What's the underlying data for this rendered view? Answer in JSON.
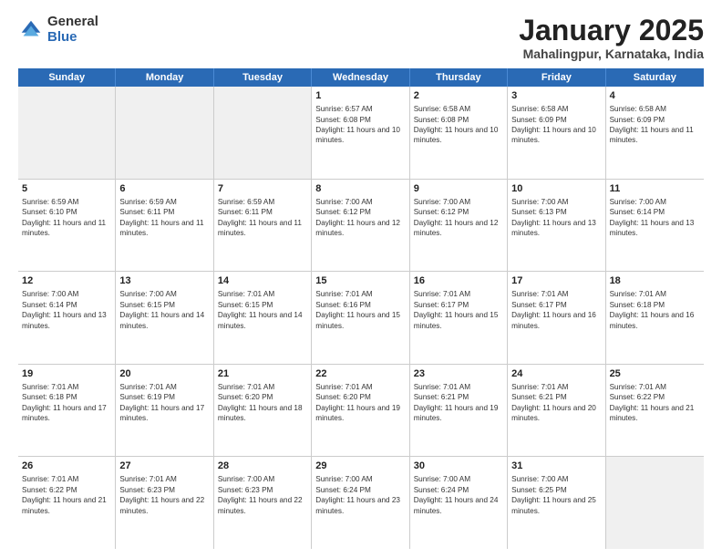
{
  "logo": {
    "general": "General",
    "blue": "Blue"
  },
  "title": {
    "month": "January 2025",
    "location": "Mahalingpur, Karnataka, India"
  },
  "header_days": [
    "Sunday",
    "Monday",
    "Tuesday",
    "Wednesday",
    "Thursday",
    "Friday",
    "Saturday"
  ],
  "weeks": [
    [
      {
        "day": "",
        "info": "",
        "shaded": true
      },
      {
        "day": "",
        "info": "",
        "shaded": true
      },
      {
        "day": "",
        "info": "",
        "shaded": true
      },
      {
        "day": "1",
        "info": "Sunrise: 6:57 AM\nSunset: 6:08 PM\nDaylight: 11 hours and 10 minutes."
      },
      {
        "day": "2",
        "info": "Sunrise: 6:58 AM\nSunset: 6:08 PM\nDaylight: 11 hours and 10 minutes."
      },
      {
        "day": "3",
        "info": "Sunrise: 6:58 AM\nSunset: 6:09 PM\nDaylight: 11 hours and 10 minutes."
      },
      {
        "day": "4",
        "info": "Sunrise: 6:58 AM\nSunset: 6:09 PM\nDaylight: 11 hours and 11 minutes."
      }
    ],
    [
      {
        "day": "5",
        "info": "Sunrise: 6:59 AM\nSunset: 6:10 PM\nDaylight: 11 hours and 11 minutes."
      },
      {
        "day": "6",
        "info": "Sunrise: 6:59 AM\nSunset: 6:11 PM\nDaylight: 11 hours and 11 minutes."
      },
      {
        "day": "7",
        "info": "Sunrise: 6:59 AM\nSunset: 6:11 PM\nDaylight: 11 hours and 11 minutes."
      },
      {
        "day": "8",
        "info": "Sunrise: 7:00 AM\nSunset: 6:12 PM\nDaylight: 11 hours and 12 minutes."
      },
      {
        "day": "9",
        "info": "Sunrise: 7:00 AM\nSunset: 6:12 PM\nDaylight: 11 hours and 12 minutes."
      },
      {
        "day": "10",
        "info": "Sunrise: 7:00 AM\nSunset: 6:13 PM\nDaylight: 11 hours and 13 minutes."
      },
      {
        "day": "11",
        "info": "Sunrise: 7:00 AM\nSunset: 6:14 PM\nDaylight: 11 hours and 13 minutes."
      }
    ],
    [
      {
        "day": "12",
        "info": "Sunrise: 7:00 AM\nSunset: 6:14 PM\nDaylight: 11 hours and 13 minutes."
      },
      {
        "day": "13",
        "info": "Sunrise: 7:00 AM\nSunset: 6:15 PM\nDaylight: 11 hours and 14 minutes."
      },
      {
        "day": "14",
        "info": "Sunrise: 7:01 AM\nSunset: 6:15 PM\nDaylight: 11 hours and 14 minutes."
      },
      {
        "day": "15",
        "info": "Sunrise: 7:01 AM\nSunset: 6:16 PM\nDaylight: 11 hours and 15 minutes."
      },
      {
        "day": "16",
        "info": "Sunrise: 7:01 AM\nSunset: 6:17 PM\nDaylight: 11 hours and 15 minutes."
      },
      {
        "day": "17",
        "info": "Sunrise: 7:01 AM\nSunset: 6:17 PM\nDaylight: 11 hours and 16 minutes."
      },
      {
        "day": "18",
        "info": "Sunrise: 7:01 AM\nSunset: 6:18 PM\nDaylight: 11 hours and 16 minutes."
      }
    ],
    [
      {
        "day": "19",
        "info": "Sunrise: 7:01 AM\nSunset: 6:18 PM\nDaylight: 11 hours and 17 minutes."
      },
      {
        "day": "20",
        "info": "Sunrise: 7:01 AM\nSunset: 6:19 PM\nDaylight: 11 hours and 17 minutes."
      },
      {
        "day": "21",
        "info": "Sunrise: 7:01 AM\nSunset: 6:20 PM\nDaylight: 11 hours and 18 minutes."
      },
      {
        "day": "22",
        "info": "Sunrise: 7:01 AM\nSunset: 6:20 PM\nDaylight: 11 hours and 19 minutes."
      },
      {
        "day": "23",
        "info": "Sunrise: 7:01 AM\nSunset: 6:21 PM\nDaylight: 11 hours and 19 minutes."
      },
      {
        "day": "24",
        "info": "Sunrise: 7:01 AM\nSunset: 6:21 PM\nDaylight: 11 hours and 20 minutes."
      },
      {
        "day": "25",
        "info": "Sunrise: 7:01 AM\nSunset: 6:22 PM\nDaylight: 11 hours and 21 minutes."
      }
    ],
    [
      {
        "day": "26",
        "info": "Sunrise: 7:01 AM\nSunset: 6:22 PM\nDaylight: 11 hours and 21 minutes."
      },
      {
        "day": "27",
        "info": "Sunrise: 7:01 AM\nSunset: 6:23 PM\nDaylight: 11 hours and 22 minutes."
      },
      {
        "day": "28",
        "info": "Sunrise: 7:00 AM\nSunset: 6:23 PM\nDaylight: 11 hours and 22 minutes."
      },
      {
        "day": "29",
        "info": "Sunrise: 7:00 AM\nSunset: 6:24 PM\nDaylight: 11 hours and 23 minutes."
      },
      {
        "day": "30",
        "info": "Sunrise: 7:00 AM\nSunset: 6:24 PM\nDaylight: 11 hours and 24 minutes."
      },
      {
        "day": "31",
        "info": "Sunrise: 7:00 AM\nSunset: 6:25 PM\nDaylight: 11 hours and 25 minutes."
      },
      {
        "day": "",
        "info": "",
        "shaded": true
      }
    ]
  ]
}
